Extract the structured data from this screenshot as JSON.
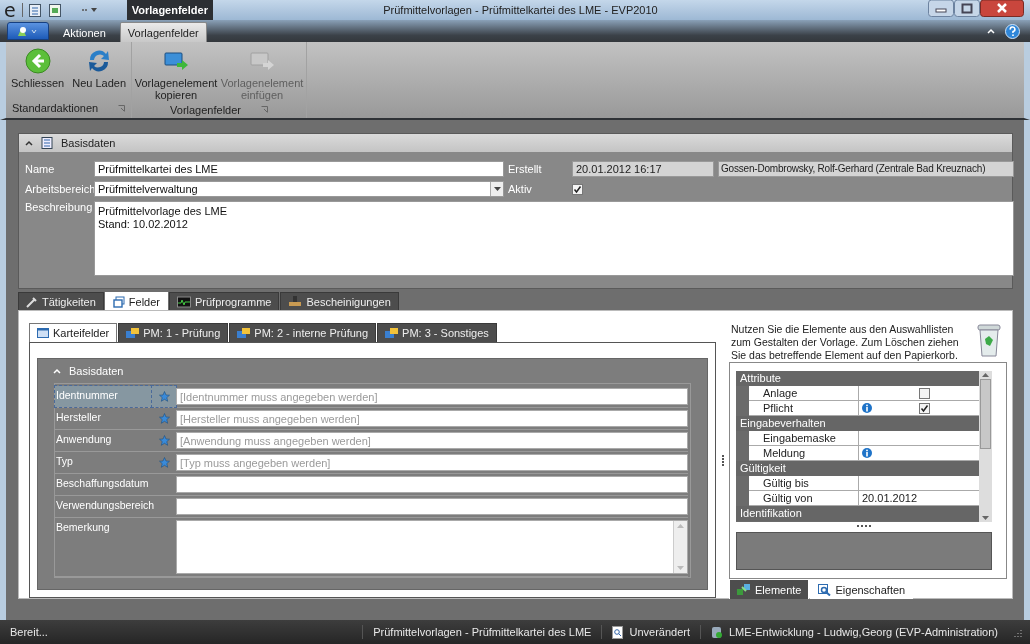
{
  "window": {
    "logo": "e",
    "title": "Prüfmittelvorlagen - Prüfmittelkartei des LME - EVP2010",
    "context_tab_group": "Vorlagenfelder"
  },
  "ribbon": {
    "tabs": [
      {
        "label": "Aktionen",
        "selected": false
      },
      {
        "label": "Vorlagenfelder",
        "selected": true
      }
    ],
    "groups": [
      {
        "label": "Standardaktionen",
        "buttons": [
          {
            "label": "Schliessen",
            "kind": "back",
            "disabled": false
          },
          {
            "label": "Neu Laden",
            "kind": "refresh",
            "disabled": false
          }
        ]
      },
      {
        "label": "Vorlagenfelder",
        "buttons": [
          {
            "label": "Vorlagenelement kopieren",
            "kind": "copy",
            "disabled": false
          },
          {
            "label": "Vorlagenelement einfügen",
            "kind": "paste",
            "disabled": true
          }
        ]
      }
    ]
  },
  "basisdaten": {
    "title": "Basisdaten",
    "name_label": "Name",
    "name_value": "Prüfmittelkartei des LME",
    "bereich_label": "Arbeitsbereich",
    "bereich_value": "Prüfmittelverwaltung",
    "beschreibung_label": "Beschreibung",
    "beschreibung_lines": [
      "Prüfmittelvorlage des LME",
      "Stand: 10.02.2012"
    ],
    "erstellt_label": "Erstellt",
    "erstellt_date": "20.01.2012 16:17",
    "erstellt_by": "Gossen-Dombrowsky, Rolf-Gerhard (Zentrale Bad Kreuznach)",
    "aktiv_label": "Aktiv",
    "aktiv_checked": true
  },
  "main_tabs": [
    {
      "label": "Tätigkeiten",
      "kind": "tool",
      "selected": false
    },
    {
      "label": "Felder",
      "kind": "window",
      "selected": true
    },
    {
      "label": "Prüfprogramme",
      "kind": "monitor",
      "selected": false
    },
    {
      "label": "Bescheinigungen",
      "kind": "stamp",
      "selected": false
    }
  ],
  "sub_tabs": [
    {
      "label": "Karteifelder",
      "kind": "card",
      "selected": true
    },
    {
      "label": "PM: 1 - Prüfung",
      "kind": "folder",
      "selected": false
    },
    {
      "label": "PM: 2 - interne Prüfung",
      "kind": "folder",
      "selected": false
    },
    {
      "label": "PM: 3 - Sonstiges",
      "kind": "folder",
      "selected": false
    }
  ],
  "form": {
    "title": "Basisdaten",
    "rows": [
      {
        "label": "Identnummer",
        "kind": "line",
        "required": true,
        "selected": true,
        "placeholder": "[Identnummer muss angegeben werden]"
      },
      {
        "label": "Hersteller",
        "kind": "line",
        "required": true,
        "selected": false,
        "placeholder": "[Hersteller muss angegeben werden]"
      },
      {
        "label": "Anwendung",
        "kind": "line",
        "required": true,
        "selected": false,
        "placeholder": "[Anwendung muss angegeben werden]"
      },
      {
        "label": "Typ",
        "kind": "line",
        "required": true,
        "selected": false,
        "placeholder": "[Typ muss angegeben werden]"
      },
      {
        "label": "Beschaffungsdatum",
        "kind": "line",
        "required": false,
        "selected": false
      },
      {
        "label": "Verwendungsbereich",
        "kind": "line",
        "required": false,
        "selected": false
      },
      {
        "label": "Bemerkung",
        "kind": "memo",
        "required": false,
        "selected": false
      }
    ]
  },
  "properties": {
    "hint": "Nutzen Sie die Elemente aus den Auswahllisten zum Gestalten der Vorlage. Zum Löschen ziehen Sie das betreffende Element auf den Papierkorb.",
    "groups": [
      {
        "name": "Attribute",
        "items": [
          {
            "name": "Anlage",
            "kind": "checkbox",
            "info": false,
            "checked": false
          },
          {
            "name": "Pflicht",
            "kind": "checkbox",
            "info": true,
            "checked": true
          }
        ]
      },
      {
        "name": "Eingabeverhalten",
        "items": [
          {
            "name": "Eingabemaske",
            "kind": "text",
            "info": false
          },
          {
            "name": "Meldung",
            "kind": "text",
            "info": true
          }
        ]
      },
      {
        "name": "Gültigkeit",
        "items": [
          {
            "name": "Gültig bis",
            "kind": "text",
            "info": false
          },
          {
            "name": "Gültig von",
            "kind": "text",
            "info": false,
            "value": "20.01.2012"
          }
        ]
      },
      {
        "name": "Identifikation"
      }
    ]
  },
  "bottom_tabs": [
    {
      "label": "Elemente",
      "kind": "elements",
      "selected": true
    },
    {
      "label": "Eigenschaften",
      "kind": "magnifier",
      "selected": false
    }
  ],
  "status_bar": {
    "message": "Bereit...",
    "document": "Prüfmittelvorlagen - Prüfmittelkartei des LME",
    "state": "Unverändert",
    "connection": "LME-Entwicklung - Ludwig,Georg (EVP-Administration)"
  }
}
